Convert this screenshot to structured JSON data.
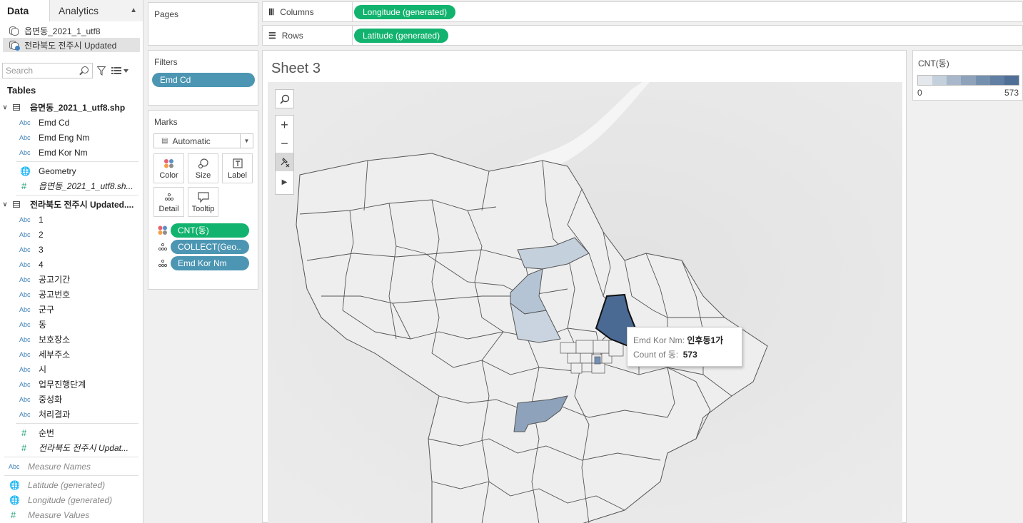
{
  "pane": {
    "tab_data": "Data",
    "tab_analytics": "Analytics",
    "datasources": [
      "읍면동_2021_1_utf8",
      "전라북도 전주시 Updated"
    ],
    "search_placeholder": "Search",
    "tables_title": "Tables",
    "table1": {
      "name": "읍면동_2021_1_utf8.shp",
      "fields": [
        {
          "type": "Abc",
          "name": "Emd Cd"
        },
        {
          "type": "Abc",
          "name": "Emd Eng Nm"
        },
        {
          "type": "Abc",
          "name": "Emd Kor Nm"
        }
      ],
      "geometry": "Geometry",
      "count_field": "읍면동_2021_1_utf8.sh..."
    },
    "table2": {
      "name": "전라북도 전주시 Updated....",
      "fields": [
        {
          "type": "Abc",
          "name": "1"
        },
        {
          "type": "Abc",
          "name": "2"
        },
        {
          "type": "Abc",
          "name": "3"
        },
        {
          "type": "Abc",
          "name": "4"
        },
        {
          "type": "Abc",
          "name": "공고기간"
        },
        {
          "type": "Abc",
          "name": "공고번호"
        },
        {
          "type": "Abc",
          "name": "군구"
        },
        {
          "type": "Abc",
          "name": "동"
        },
        {
          "type": "Abc",
          "name": "보호장소"
        },
        {
          "type": "Abc",
          "name": "세부주소"
        },
        {
          "type": "Abc",
          "name": "시"
        },
        {
          "type": "Abc",
          "name": "업무진행단계"
        },
        {
          "type": "Abc",
          "name": "중성화"
        },
        {
          "type": "Abc",
          "name": "처리결과"
        }
      ],
      "measure": "순번",
      "count_field": "전라북도 전주시 Updat..."
    },
    "generated": [
      {
        "type": "Abc",
        "name": "Measure Names"
      },
      {
        "type": "globe",
        "name": "Latitude (generated)"
      },
      {
        "type": "globe",
        "name": "Longitude (generated)"
      },
      {
        "type": "#",
        "name": "Measure Values"
      }
    ]
  },
  "shelves": {
    "pages": "Pages",
    "filters": "Filters",
    "filter_pill": "Emd Cd",
    "columns_label": "Columns",
    "columns_pill": "Longitude (generated)",
    "rows_label": "Rows",
    "rows_pill": "Latitude (generated)"
  },
  "marks": {
    "title": "Marks",
    "type": "Automatic",
    "buttons": [
      "Color",
      "Size",
      "Label",
      "Detail",
      "Tooltip"
    ],
    "pills": [
      "CNT(동)",
      "COLLECT(Geo..",
      "Emd Kor Nm"
    ]
  },
  "sheet": {
    "title": "Sheet 3"
  },
  "tooltip": {
    "line1_label": "Emd Kor Nm:",
    "line1_value": "인후동1가",
    "line2_label": "Count of 동:",
    "line2_value": "573"
  },
  "legend": {
    "title": "CNT(동)",
    "min": "0",
    "max": "573",
    "colors": [
      "#e4e8ec",
      "#c4d0dc",
      "#a8b8ca",
      "#8ea2bb",
      "#7590af",
      "#617fa2",
      "#4f6f96"
    ]
  },
  "colors": {
    "green_pill": "#12b36e",
    "blue_pill": "#4c96b3",
    "highlight": "#4a6a94"
  }
}
